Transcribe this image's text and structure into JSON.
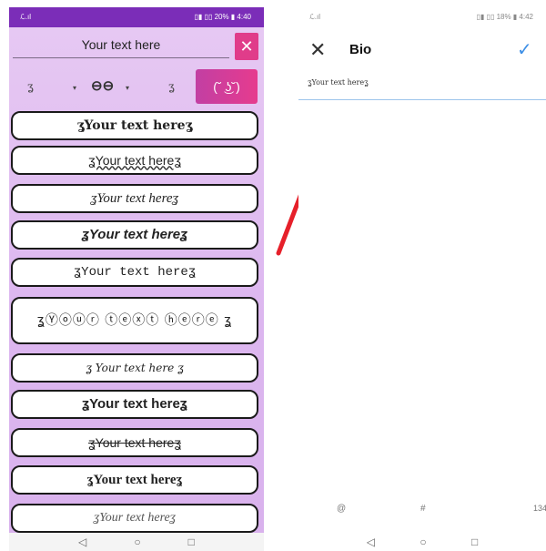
{
  "left_phone": {
    "status_bar": {
      "carrier": "ℒ.ıl",
      "right": "▯▮ ▯▯ 20% ▮ 4:40"
    },
    "text_input": {
      "value": "Your text here"
    },
    "clear_button": {
      "icon": "close-icon",
      "label": "✕"
    },
    "toolbar": {
      "deco_left": "ʓ",
      "caret_left": "▾",
      "link_icon": "⊖⊖",
      "caret_right": "▾",
      "deco_right": "ʓ",
      "kaomoji_label": "(˘ ͜ʖ˘)"
    },
    "styles": [
      "ʓYour text hereʓ",
      "ʓYour text hereʓ",
      "ʓYour text hereʓ",
      "ʓYour text hereʓ",
      "ʓYour text hereʓ",
      "ʓⓎⓞⓤⓡ ⓣⓔⓧⓣ ⓗⓔⓡⓔ ʓ",
      "ʓ Your text here ʓ",
      "ʓYour text hereʓ",
      "ʓYour text hereʓ",
      "ʓYour text hereʓ",
      "ʓYour text hereʓ"
    ],
    "nav": {
      "back": "◁",
      "home": "○",
      "recent": "□"
    }
  },
  "right_phone": {
    "status_bar": {
      "carrier": "ℒ.ıl",
      "right": "▯▮ ▯▯ 18% ▮ 4:42"
    },
    "header": {
      "close_label": "✕",
      "title": "Bio",
      "check_label": "✓"
    },
    "bio_value": "ʓYour text hereʓ",
    "bottom": {
      "at": "@",
      "hash": "#",
      "count": "134"
    },
    "nav": {
      "back": "◁",
      "home": "○",
      "recent": "□"
    }
  },
  "colors": {
    "accent": "#e03c8a",
    "app_bg": "#dcb6ef",
    "status": "#7b2db8",
    "arrow": "#e6202a",
    "check": "#3d8fe6"
  }
}
